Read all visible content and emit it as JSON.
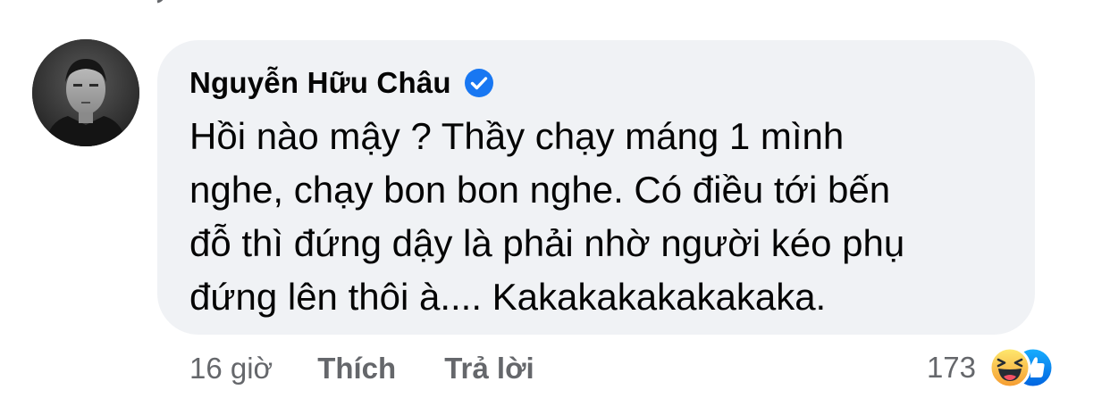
{
  "comment": {
    "author": "Nguyễn Hữu Châu",
    "verified": true,
    "text_lines": [
      "Hồi nào mậy ? Thầy chạy máng 1 mình",
      "nghe, chạy bon bon nghe. Có điều tới bến",
      "đỗ thì đứng dậy là phải nhờ người kéo phụ",
      "đứng lên thôi à.... Kakakakakakakaka."
    ],
    "timestamp": "16 giờ",
    "actions": {
      "like_label": "Thích",
      "reply_label": "Trả lời"
    },
    "reactions": {
      "count": "173",
      "icons": [
        "haha-icon",
        "like-icon"
      ]
    }
  },
  "colors": {
    "bubble_bg": "#f0f2f5",
    "secondary_text": "#65676b",
    "verified_blue": "#1877f2",
    "haha_yellow": "#f7b125",
    "like_blue": "#1877f2"
  }
}
